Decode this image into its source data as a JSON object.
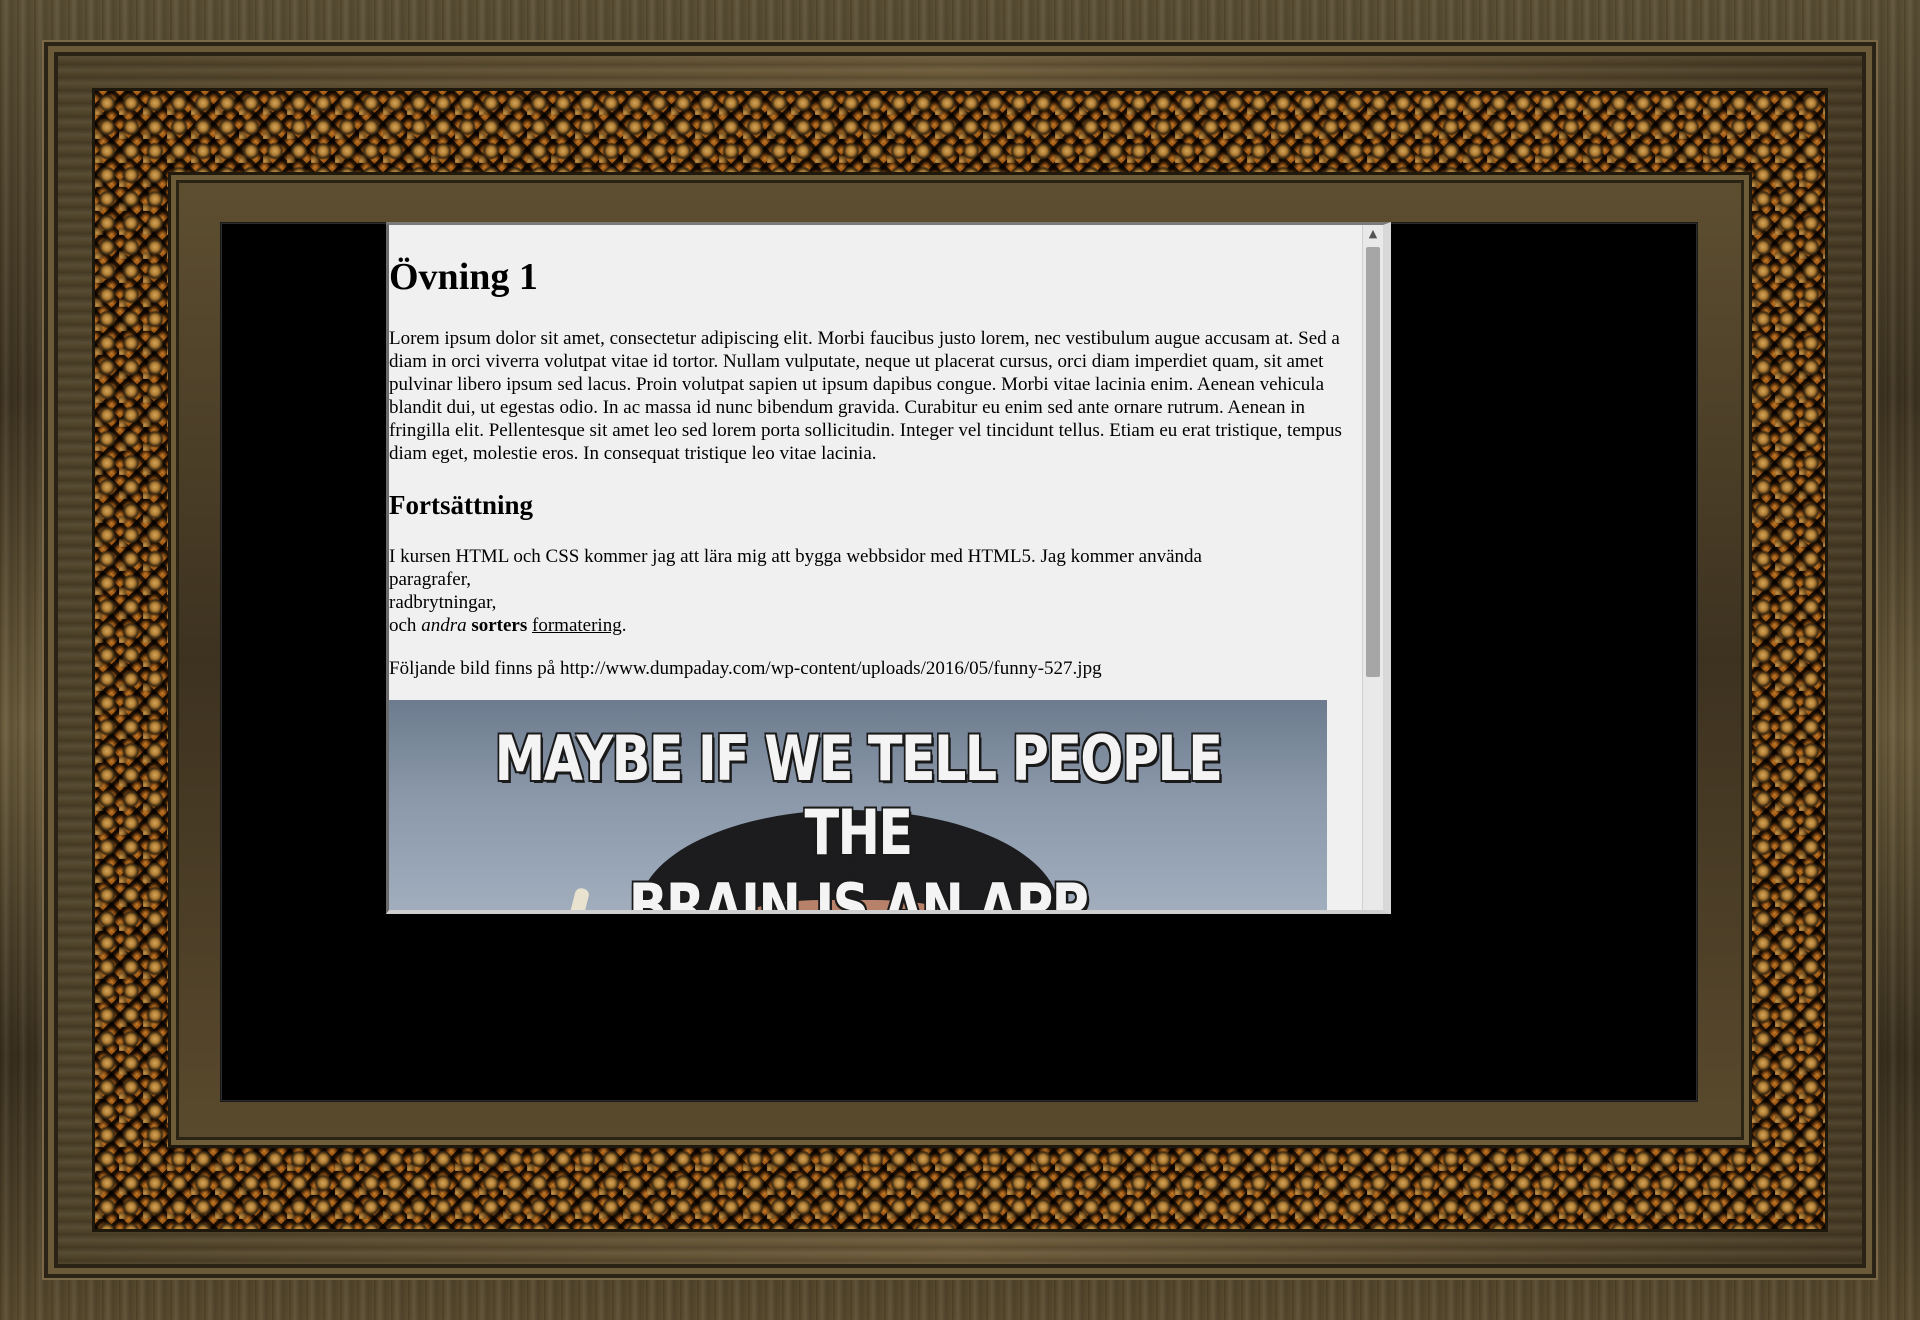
{
  "page": {
    "heading": "Övning 1",
    "lorem": "Lorem ipsum dolor sit amet, consectetur adipiscing elit. Morbi faucibus justo lorem, nec vestibulum augue accusam at. Sed a diam in orci viverra volutpat vitae id tortor. Nullam vulputate, neque ut placerat cursus, orci diam imperdiet quam, sit amet pulvinar libero ipsum sed lacus. Proin volutpat sapien ut ipsum dapibus congue. Morbi vitae lacinia enim. Aenean vehicula blandit dui, ut egestas odio. In ac massa id nunc bibendum gravida. Curabitur eu enim sed ante ornare rutrum. Aenean in fringilla elit. Pellentesque sit amet leo sed lorem porta sollicitudin. Integer vel tincidunt tellus. Etiam eu erat tristique, tempus diam eget, molestie eros. In consequat tristique leo vitae lacinia.",
    "subheading": "Fortsättning",
    "course_intro": "I kursen HTML och CSS kommer jag att lära mig att bygga webbsidor med HTML5. Jag kommer använda",
    "line_paragrafer": "paragrafer,",
    "line_radbrytningar": "radbrytningar,",
    "word_och": "och ",
    "word_andra": "andra",
    "word_sorters": "sorters",
    "link_formatering": "formatering",
    "period": ".",
    "source_text": "Följande bild finns på http://www.dumpaday.com/wp-content/uploads/2016/05/funny-527.jpg",
    "meme": {
      "caption_line1": "MAYBE IF WE TELL PEOPLE THE",
      "caption_line2": "BRAIN IS AN APP"
    }
  },
  "scrollbar": {
    "up_arrow_icon": "triangle-up"
  },
  "colors": {
    "page_background": "#f0f0f0",
    "canvas_background": "#000000",
    "frame_gold": "#c08a3c"
  }
}
